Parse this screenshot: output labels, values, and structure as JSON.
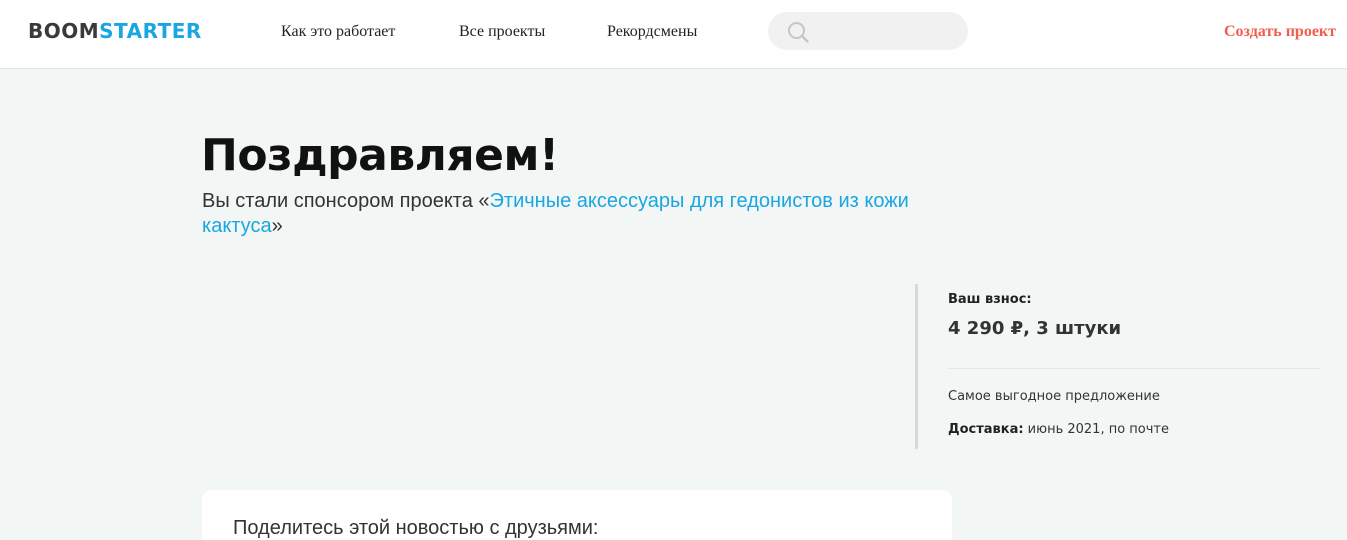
{
  "header": {
    "logo": {
      "part1": "BOOM",
      "part2": "STARTER"
    },
    "nav": [
      {
        "label": "Как это работает"
      },
      {
        "label": "Все проекты"
      },
      {
        "label": "Рекордсмены"
      }
    ],
    "search": {
      "value": "",
      "placeholder": ""
    },
    "create_project": "Создать проект"
  },
  "main": {
    "title": "Поздравляем!",
    "subtitle_prefix": "Вы стали спонсором проекта «",
    "project_name": "Этичные аксессуары для гедонистов из кожи кактуса",
    "subtitle_suffix": "»"
  },
  "pledge": {
    "label": "Ваш взнос:",
    "amount": "4 290 ₽, 3 штуки",
    "offer": "Самое выгодное предложение",
    "delivery_label": "Доставка:",
    "delivery_value": " июнь 2021, по почте"
  },
  "share": {
    "title": "Поделитесь этой новостью с друзьями:"
  },
  "colors": {
    "accent": "#1aa6e0",
    "create": "#f25d4e",
    "background": "#f2f7f6"
  }
}
